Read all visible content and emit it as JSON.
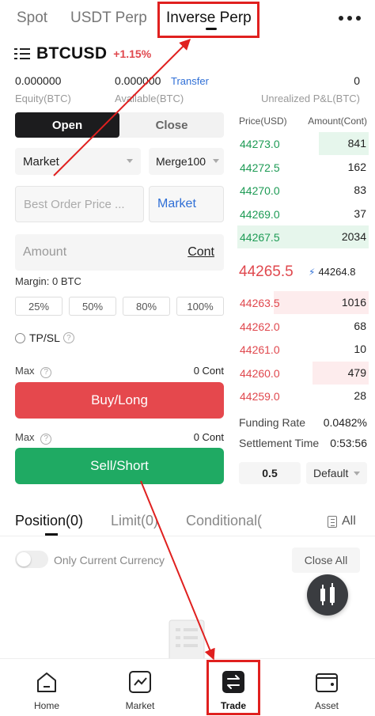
{
  "top_tabs": [
    {
      "label": "Spot"
    },
    {
      "label": "USDT Perp"
    },
    {
      "label": "Inverse Perp"
    }
  ],
  "symbol": {
    "name": "BTCUSD",
    "change": "+1.15%"
  },
  "account": {
    "equity_value": "0.000000",
    "equity_label": "Equity(BTC)",
    "available_value": "0.000000",
    "available_label": "Available(BTC)",
    "transfer_label": "Transfer",
    "unrealized_value": "0",
    "unrealized_label": "Unrealized P&L(BTC)"
  },
  "order_form": {
    "open_label": "Open",
    "close_label": "Close",
    "order_type": "Market",
    "merge": "Merge100",
    "price_placeholder": "Best Order Price ...",
    "market_label": "Market",
    "amount_placeholder": "Amount",
    "amount_unit": "Cont",
    "margin_label": "Margin:",
    "margin_value": "0 BTC",
    "percent_options": [
      "25%",
      "50%",
      "80%",
      "100%"
    ],
    "tpsl_label": "TP/SL",
    "max_label": "Max",
    "buy_max_value": "0 Cont",
    "sell_max_value": "0 Cont",
    "buy_label": "Buy/Long",
    "sell_label": "Sell/Short"
  },
  "order_book": {
    "price_header": "Price(USD)",
    "amount_header": "Amount(Cont)",
    "asks": [
      {
        "price": "44273.0",
        "size": "841",
        "depth": 0.38
      },
      {
        "price": "44272.5",
        "size": "162",
        "depth": 0.0
      },
      {
        "price": "44270.0",
        "size": "83",
        "depth": 0.0
      },
      {
        "price": "44269.0",
        "size": "37",
        "depth": 0.0
      },
      {
        "price": "44267.5",
        "size": "2034",
        "depth": 1.0
      }
    ],
    "last_price": "44265.5",
    "mark_price": "44264.8",
    "bids": [
      {
        "price": "44263.5",
        "size": "1016",
        "depth": 0.72
      },
      {
        "price": "44262.0",
        "size": "68",
        "depth": 0.0
      },
      {
        "price": "44261.0",
        "size": "10",
        "depth": 0.0
      },
      {
        "price": "44260.0",
        "size": "479",
        "depth": 0.43
      },
      {
        "price": "44259.0",
        "size": "28",
        "depth": 0.0
      }
    ],
    "funding_rate_label": "Funding Rate",
    "funding_rate_value": "0.0482%",
    "settlement_label": "Settlement Time",
    "settlement_value": "0:53:56",
    "precision": "0.5",
    "view_mode": "Default"
  },
  "position_tabs": [
    {
      "label": "Position(0)"
    },
    {
      "label": "Limit(0)"
    },
    {
      "label": "Conditional("
    }
  ],
  "all_label": "All",
  "only_current_label": "Only Current Currency",
  "close_all_label": "Close All",
  "bottom_nav": [
    {
      "label": "Home",
      "icon": "home-icon"
    },
    {
      "label": "Market",
      "icon": "market-chart-icon"
    },
    {
      "label": "Trade",
      "icon": "trade-swap-icon"
    },
    {
      "label": "Asset",
      "icon": "wallet-icon"
    }
  ],
  "colors": {
    "buy_green": "#1faa63",
    "sell_red": "#e5484d",
    "link_blue": "#2f6fd6",
    "annotation_red": "#e0201f"
  }
}
